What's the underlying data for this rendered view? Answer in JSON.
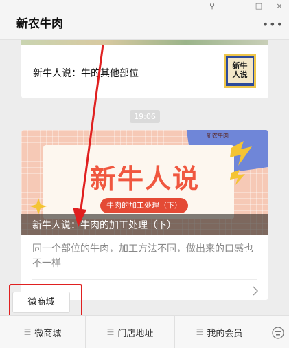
{
  "window": {
    "title": "新农牛肉",
    "controls": {
      "pin": "⚲",
      "minimize": "−",
      "maximize": "□",
      "close": "×"
    },
    "more_label": "•••"
  },
  "articles": [
    {
      "title": "新牛人说：牛的其他部位",
      "thumb_line1": "新牛",
      "thumb_line2": "人说"
    }
  ],
  "timestamp": "19:06",
  "featured": {
    "cover_title": "新牛人说",
    "cover_subtitle": "牛肉的加工处理（下）",
    "brand": "新农牛肉",
    "caption": "新牛人说：牛肉的加工处理（下）",
    "summary": "同一个部位的牛肉，加工方法不同，做出来的口感也不一样"
  },
  "popup": {
    "label": "微商城"
  },
  "bottom_menu": [
    {
      "label": "微商城"
    },
    {
      "label": "门店地址"
    },
    {
      "label": "我的会员"
    }
  ],
  "colors": {
    "accent": "#f0573f",
    "annotation": "#e02020",
    "cover_bg": "#f6c9b6"
  }
}
